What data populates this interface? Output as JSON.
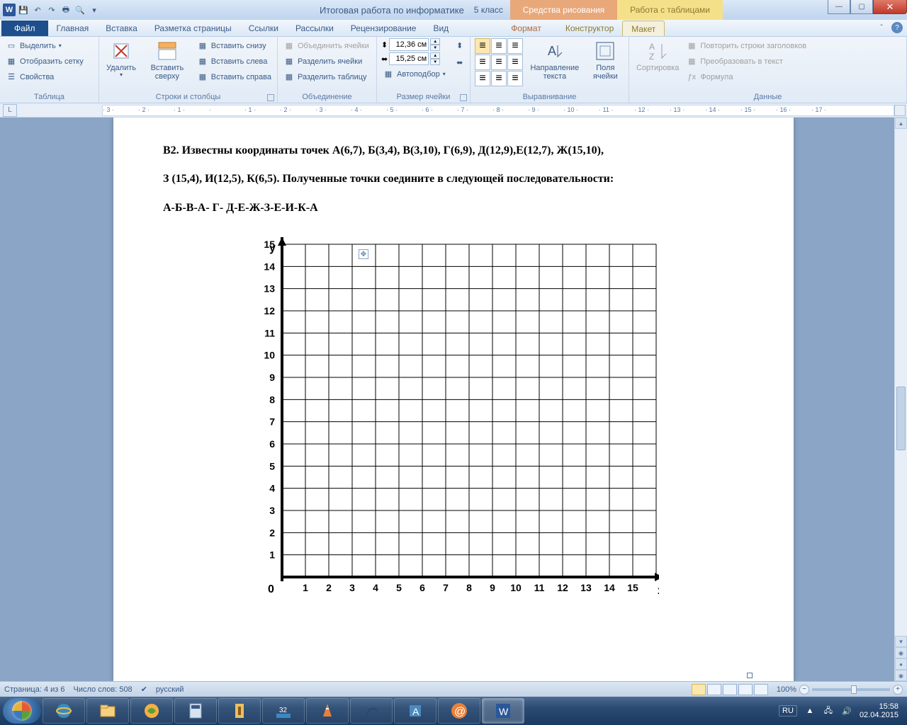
{
  "title": {
    "doc": "Итоговая работа по информатике",
    "class": "5 класс",
    "app": "Microsoft Word"
  },
  "context_tabs": {
    "drawing": "Средства рисования",
    "table": "Работа с таблицами"
  },
  "tabs": {
    "file": "Файл",
    "home": "Главная",
    "insert": "Вставка",
    "layout": "Разметка страницы",
    "refs": "Ссылки",
    "mail": "Рассылки",
    "review": "Рецензирование",
    "view": "Вид",
    "format": "Формат",
    "design": "Конструктор",
    "tlayout": "Макет"
  },
  "ribbon": {
    "table": {
      "select": "Выделить",
      "gridlines": "Отобразить сетку",
      "props": "Свойства",
      "label": "Таблица"
    },
    "rowscols": {
      "delete": "Удалить",
      "insert_above": "Вставить сверху",
      "insert_below": "Вставить снизу",
      "insert_left": "Вставить слева",
      "insert_right": "Вставить справа",
      "label": "Строки и столбцы"
    },
    "merge": {
      "merge": "Объединить ячейки",
      "split": "Разделить ячейки",
      "split_table": "Разделить таблицу",
      "label": "Объединение"
    },
    "cellsize": {
      "height": "12,36 см",
      "width": "15,25 см",
      "autofit": "Автоподбор",
      "label": "Размер ячейки"
    },
    "align": {
      "direction": "Направление текста",
      "margins": "Поля ячейки",
      "label": "Выравнивание"
    },
    "data": {
      "sort": "Сортировка",
      "repeat": "Повторить строки заголовков",
      "convert": "Преобразовать в текст",
      "formula": "Формула",
      "label": "Данные"
    }
  },
  "ruler_numbers": [
    "3",
    "2",
    "1",
    "",
    "1",
    "2",
    "3",
    "4",
    "5",
    "6",
    "7",
    "8",
    "9",
    "10",
    "11",
    "12",
    "13",
    "14",
    "15",
    "16",
    "17"
  ],
  "doc": {
    "p1": "В2. Известны координаты точек А(6,7), Б(3,4), В(3,10), Г(6,9), Д(12,9),Е(12,7), Ж(15,10),",
    "p2": "З (15,4), И(12,5), К(6,5). Полученные точки соедините в следующей последовательности:",
    "p3": "А-Б-В-А- Г- Д-Е-Ж-З-Е-И-К-А"
  },
  "chart_data": {
    "type": "scatter",
    "title": "",
    "xlabel": "x",
    "ylabel": "y",
    "xlim": [
      0,
      16
    ],
    "ylim": [
      0,
      16
    ],
    "xticks": [
      1,
      2,
      3,
      4,
      5,
      6,
      7,
      8,
      9,
      10,
      11,
      12,
      13,
      14,
      15
    ],
    "yticks": [
      1,
      2,
      3,
      4,
      5,
      6,
      7,
      8,
      9,
      10,
      11,
      12,
      13,
      14,
      15
    ],
    "origin_label": "0",
    "points": {
      "А": [
        6,
        7
      ],
      "Б": [
        3,
        4
      ],
      "В": [
        3,
        10
      ],
      "Г": [
        6,
        9
      ],
      "Д": [
        12,
        9
      ],
      "Е": [
        12,
        7
      ],
      "Ж": [
        15,
        10
      ],
      "З": [
        15,
        4
      ],
      "И": [
        12,
        5
      ],
      "К": [
        6,
        5
      ]
    },
    "path": [
      "А",
      "Б",
      "В",
      "А",
      "Г",
      "Д",
      "Е",
      "Ж",
      "З",
      "Е",
      "И",
      "К",
      "А"
    ]
  },
  "status": {
    "page": "Страница: 4 из 6",
    "words": "Число слов: 508",
    "lang": "русский",
    "zoom": "100%"
  },
  "tray": {
    "lang": "RU",
    "time": "15:58",
    "date": "02.04.2015"
  }
}
